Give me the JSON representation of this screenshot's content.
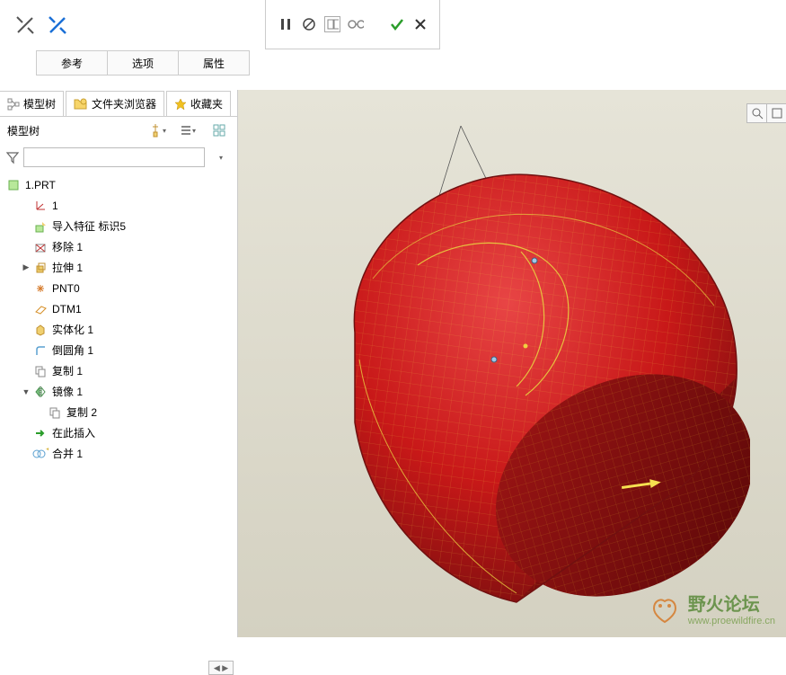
{
  "top_tabs": {
    "reference": "参考",
    "options": "选项",
    "attributes": "属性"
  },
  "sub_tabs": {
    "model_tree": "模型树",
    "file_browser": "文件夹浏览器",
    "favorites": "收藏夹"
  },
  "tree_header": {
    "title": "模型树"
  },
  "filter": {
    "placeholder": ""
  },
  "tree": {
    "root": "1.PRT",
    "items": [
      {
        "label": "1"
      },
      {
        "label": "导入特征 标识5"
      },
      {
        "label": "移除 1"
      },
      {
        "label": "拉伸 1"
      },
      {
        "label": "PNT0"
      },
      {
        "label": "DTM1"
      },
      {
        "label": "实体化 1"
      },
      {
        "label": "倒圆角 1"
      },
      {
        "label": "复制 1"
      },
      {
        "label": "镜像 1"
      },
      {
        "label": "复制 2"
      },
      {
        "label": "在此插入"
      },
      {
        "label": "合并 1"
      }
    ]
  },
  "watermark": {
    "title": "野火论坛",
    "url": "www.proewildfire.cn"
  }
}
